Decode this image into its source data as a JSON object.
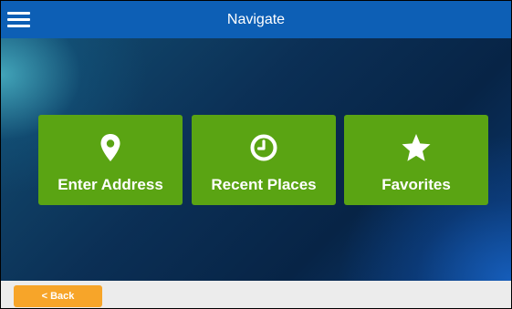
{
  "header": {
    "title": "Navigate",
    "menu_icon": "hamburger-menu-icon",
    "background_color": "#0d5fb5"
  },
  "tiles": [
    {
      "label": "Enter Address",
      "icon": "location-pin-icon"
    },
    {
      "label": "Recent Places",
      "icon": "clock-icon"
    },
    {
      "label": "Favorites",
      "icon": "star-icon"
    }
  ],
  "tile_color": "#5aa413",
  "footer": {
    "back_label": "< Back",
    "back_color": "#f7a529"
  }
}
